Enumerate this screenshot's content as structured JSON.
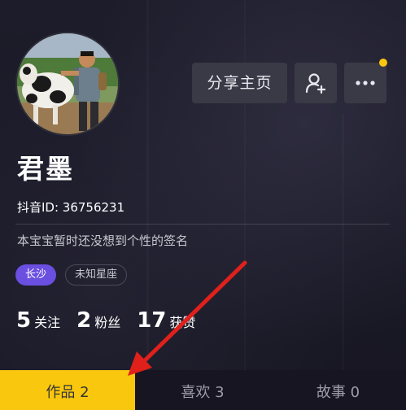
{
  "header": {
    "share_label": "分享主页",
    "add_friend_icon": "add-friend-icon",
    "more_icon": "more-dots-icon",
    "notify_color": "#f9c80e"
  },
  "profile": {
    "nickname": "君墨",
    "douyin_id": "抖音ID: 36756231",
    "signature": "本宝宝暂时还没想到个性的签名",
    "tags": {
      "city": "长沙",
      "zodiac": "未知星座"
    }
  },
  "stats": {
    "following_count": "5",
    "following_label": "关注",
    "followers_count": "2",
    "followers_label": "粉丝",
    "likes_count": "17",
    "likes_label": "获赞"
  },
  "tabs": [
    {
      "label": "作品 2",
      "active": true
    },
    {
      "label": "喜欢 3",
      "active": false
    },
    {
      "label": "故事 0",
      "active": false
    }
  ],
  "colors": {
    "accent": "#f9c80e",
    "tag_purple": "#6a4fe0",
    "arrow": "#e0201b"
  }
}
